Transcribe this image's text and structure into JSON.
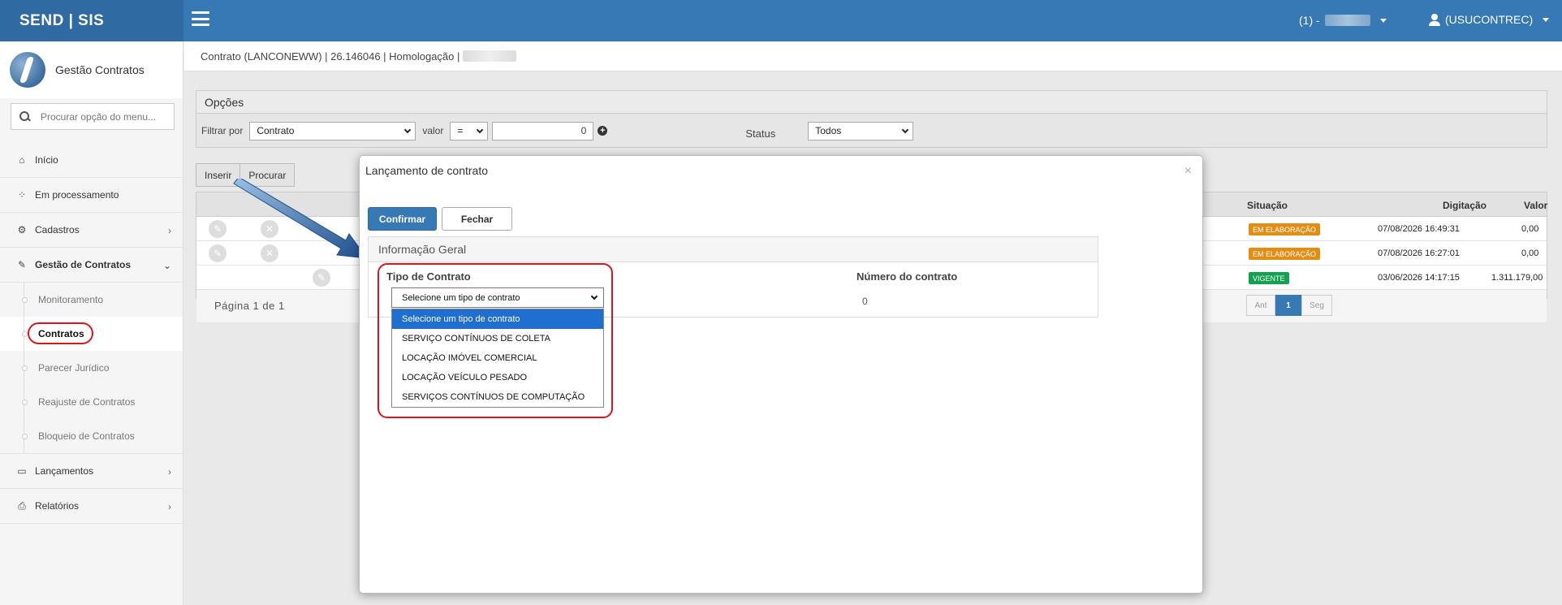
{
  "topbar": {
    "brand": "SEND | SIS",
    "company_prefix": "(1) -",
    "user": "(USUCONTREC)"
  },
  "sidebar": {
    "title": "Gestão Contratos",
    "search_placeholder": "Procurar opção do menu...",
    "items": [
      {
        "label": "Início",
        "icon": "home-icon"
      },
      {
        "label": "Em processamento",
        "icon": "spinner-icon"
      },
      {
        "label": "Cadastros",
        "icon": "cogs-icon"
      },
      {
        "label": "Gestão de Contratos",
        "icon": "edit-icon"
      },
      {
        "label": "Lançamentos",
        "icon": "laptop-icon"
      },
      {
        "label": "Relatórios",
        "icon": "print-icon"
      }
    ],
    "submenu": [
      {
        "label": "Monitoramento"
      },
      {
        "label": "Contratos"
      },
      {
        "label": "Parecer Jurídico"
      },
      {
        "label": "Reajuste de Contratos"
      },
      {
        "label": "Bloqueio de Contratos"
      }
    ]
  },
  "main": {
    "breadcrumb": "Contrato (LANCONEWW) | 26.146046 | Homologação |",
    "options_title": "Opções",
    "filter_label": "Filtrar por",
    "filter_value": "Contrato",
    "valor_label": "valor",
    "operator": "=",
    "valor_value": "0",
    "status_label": "Status",
    "status_value": "Todos",
    "insert_button": "Inserir",
    "search_button": "Procurar",
    "grid": {
      "columns": [
        "Situação",
        "Digitação",
        "Valor"
      ],
      "rows": [
        {
          "situacao": "EM ELABORAÇÃO",
          "digitacao": "07/08/2026 16:49:31",
          "valor": "0,00"
        },
        {
          "situacao": "EM ELABORAÇÃO",
          "digitacao": "07/08/2026 16:27:01",
          "valor": "0,00"
        },
        {
          "situacao": "VIGENTE",
          "digitacao": "03/06/2026 14:17:15",
          "valor": "1.311.179,00"
        }
      ],
      "pager_text": "Página 1 de 1",
      "pager_prev": "Ant",
      "pager_current": "1",
      "pager_next": "Seg"
    }
  },
  "modal": {
    "title": "Lançamento de contrato",
    "close": "×",
    "confirm_button": "Confirmar",
    "close_button": "Fechar",
    "section_title": "Informação Geral",
    "tipo_label": "Tipo de Contrato",
    "numero_label": "Número do contrato",
    "numero_value": "0",
    "tipo_selected": "Selecione um tipo de contrato",
    "tipo_options": [
      "Selecione um tipo de contrato",
      "SERVIÇO CONTÍNUOS DE COLETA",
      "LOCAÇÃO IMÓVEL COMERCIAL",
      "LOCAÇÃO VEÍCULO PESADO",
      "SERVIÇOS CONTÍNUOS DE COMPUTAÇÃO"
    ]
  },
  "colors": {
    "header_blue": "#3679b5",
    "brand_blue": "#2f6aa3",
    "badge_orange": "#e38d13",
    "badge_green": "#13a14f",
    "highlight_red": "#d9151b",
    "dropdown_selected": "#1e6fd0"
  }
}
